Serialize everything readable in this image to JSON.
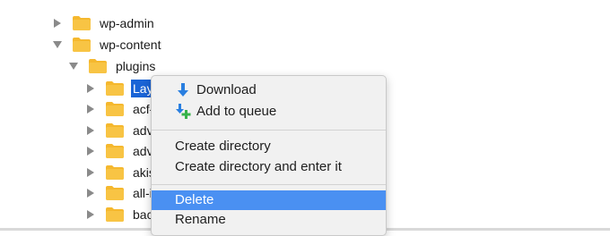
{
  "tree": {
    "items": [
      {
        "label": "wp-admin",
        "expanded": false
      },
      {
        "label": "wp-content",
        "expanded": true
      },
      {
        "label": "plugins",
        "expanded": true
      },
      {
        "label": "Lay",
        "expanded": false,
        "selected": true
      },
      {
        "label": "acf-",
        "expanded": false
      },
      {
        "label": "adv",
        "expanded": false
      },
      {
        "label": "adv",
        "expanded": false
      },
      {
        "label": "akis",
        "expanded": false
      },
      {
        "label": "all-i",
        "expanded": false
      },
      {
        "label": "bac",
        "expanded": false
      }
    ]
  },
  "context_menu": {
    "download": {
      "label": "Download",
      "icon": "download-arrow-icon"
    },
    "add_to_queue": {
      "label": "Add to queue",
      "icon": "add-to-queue-icon"
    },
    "create_directory": "Create directory",
    "create_directory_enter": "Create directory and enter it",
    "delete": "Delete",
    "rename": "Rename"
  },
  "colors": {
    "folder": "#f5b82e",
    "selection": "#1a64d6",
    "menu_highlight": "#4a90f2",
    "download_icon": "#2a7fe0",
    "queue_plus": "#37b34a"
  }
}
